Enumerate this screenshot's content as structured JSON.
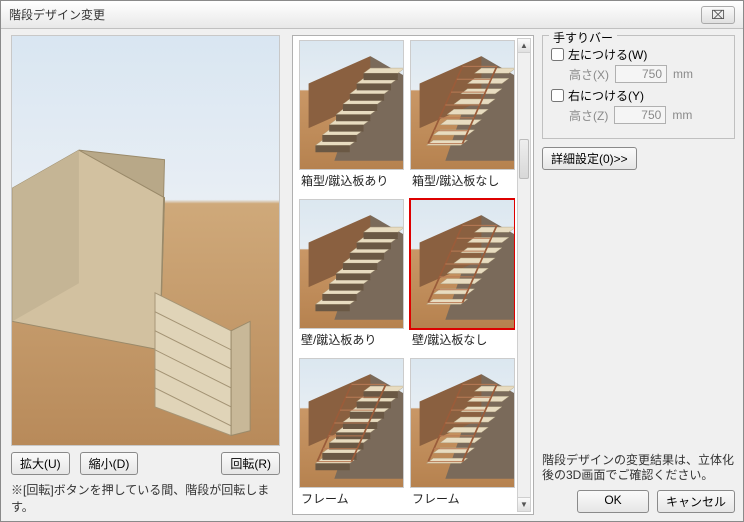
{
  "window": {
    "title": "階段デザイン変更",
    "close_glyph": "⌧"
  },
  "preview": {
    "zoom_in": "拡大(U)",
    "zoom_out": "縮小(D)",
    "rotate": "回転(R)",
    "hint": "※[回転]ボタンを押している間、階段が回転します。"
  },
  "gallery": {
    "items": [
      {
        "label": "箱型/蹴込板あり",
        "selected": false,
        "rail": false,
        "riser": true
      },
      {
        "label": "箱型/蹴込板なし",
        "selected": false,
        "rail": true,
        "riser": false
      },
      {
        "label": "壁/蹴込板あり",
        "selected": false,
        "rail": false,
        "riser": true
      },
      {
        "label": "壁/蹴込板なし",
        "selected": true,
        "rail": true,
        "riser": false
      },
      {
        "label": "フレーム",
        "selected": false,
        "rail": true,
        "riser": true
      },
      {
        "label": "フレーム",
        "selected": false,
        "rail": true,
        "riser": false
      }
    ]
  },
  "handrail": {
    "legend": "手すりバー",
    "left_label": "左につける(W)",
    "left_height_label": "高さ(X)",
    "left_height_value": "750",
    "right_label": "右につける(Y)",
    "right_height_label": "高さ(Z)",
    "right_height_value": "750",
    "unit": "mm"
  },
  "detail_button": "詳細設定(0)>>",
  "footer": {
    "note": "階段デザインの変更結果は、立体化後の3D画面でご確認ください。",
    "ok": "OK",
    "cancel": "キャンセル"
  }
}
